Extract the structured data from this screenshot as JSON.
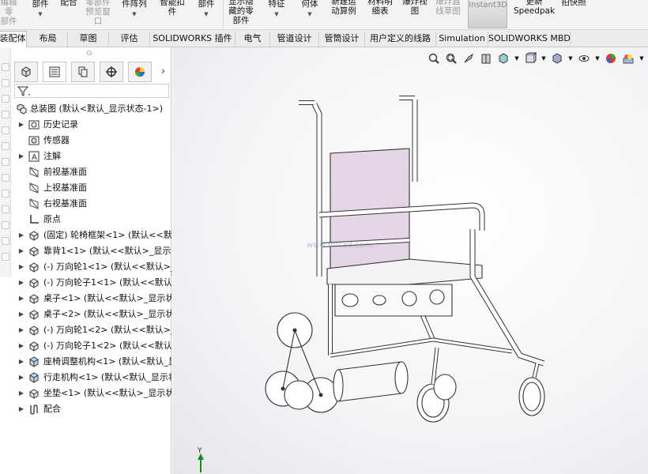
{
  "ribbon": {
    "items": [
      {
        "label": "编辑零\n部件",
        "gray": true
      },
      {
        "label": "部件",
        "dropdown": true
      },
      {
        "label": "配合",
        "dropdown": false
      },
      {
        "label": "零部件\n预览窗\n口",
        "gray": true
      },
      {
        "label": "件阵列",
        "dropdown": true
      },
      {
        "label": "智能扣\n件",
        "dropdown": false
      },
      {
        "label": "部件",
        "dropdown": true
      },
      {
        "label": "显示隐\n藏的零\n部件",
        "dropdown": false
      },
      {
        "label": "特征",
        "dropdown": true
      },
      {
        "label": "何体",
        "dropdown": true
      },
      {
        "label": "新建运\n动算例",
        "dropdown": false
      },
      {
        "label": "材料明\n细表",
        "dropdown": false
      },
      {
        "label": "爆炸视\n图",
        "dropdown": false
      },
      {
        "label": "爆炸直\n线草图",
        "gray": true
      },
      {
        "label": "Instant3D",
        "gray": true
      },
      {
        "label": "更新\nSpeedpak",
        "dropdown": false
      },
      {
        "label": "拍快照",
        "dropdown": false
      }
    ]
  },
  "tabs": [
    {
      "label": "装配体",
      "active": true
    },
    {
      "label": "布局"
    },
    {
      "label": "草图"
    },
    {
      "label": "评估"
    },
    {
      "label": "SOLIDWORKS 插件"
    },
    {
      "label": "电气"
    },
    {
      "label": "管道设计"
    },
    {
      "label": "管筒设计"
    },
    {
      "label": "用户定义的线路"
    },
    {
      "label": "Simulation"
    },
    {
      "label": "SOLIDWORKS MBD"
    }
  ],
  "tree": {
    "root": "总装图  (默认<默认_显示状态-1>)",
    "nodes": [
      {
        "label": "历史记录",
        "icon": "history-icon",
        "expandable": true
      },
      {
        "label": "传感器",
        "icon": "sensor-icon",
        "expandable": false
      },
      {
        "label": "注解",
        "icon": "annotation-icon",
        "expandable": true
      },
      {
        "label": "前视基准面",
        "icon": "plane-icon",
        "expandable": false
      },
      {
        "label": "上视基准面",
        "icon": "plane-icon",
        "expandable": false
      },
      {
        "label": "右视基准面",
        "icon": "plane-icon",
        "expandable": false
      },
      {
        "label": "原点",
        "icon": "origin-icon",
        "expandable": false
      },
      {
        "label": "(固定) 轮椅框架<1> (默认<<默",
        "icon": "part-icon",
        "expandable": true
      },
      {
        "label": "靠背1<1> (默认<<默认>_显示状",
        "icon": "part-icon",
        "expandable": true
      },
      {
        "label": "(-) 万向轮1<1> (默认<<默认>_",
        "icon": "part-icon",
        "expandable": true
      },
      {
        "label": "(-) 万向轮子1<1> (默认<<默认",
        "icon": "part-icon",
        "expandable": true
      },
      {
        "label": "桌子<1> (默认<<默认>_显示状",
        "icon": "part-icon",
        "expandable": true
      },
      {
        "label": "桌子<2> (默认<<默认>_显示状",
        "icon": "part-icon",
        "expandable": true
      },
      {
        "label": "(-) 万向轮1<2> (默认<<默认>_",
        "icon": "part-icon",
        "expandable": true
      },
      {
        "label": "(-) 万向轮子1<2> (默认<<默认",
        "icon": "part-icon",
        "expandable": true
      },
      {
        "label": "座椅调整机构<1> (默认<默认_显",
        "icon": "assembly-icon",
        "expandable": true
      },
      {
        "label": "行走机构<1> (默认<默认_显示状",
        "icon": "assembly-icon",
        "expandable": true
      },
      {
        "label": "坐垫<1> (默认<<默认>_显示状",
        "icon": "part-icon",
        "expandable": true
      },
      {
        "label": "配合",
        "icon": "mate-icon",
        "expandable": true
      }
    ]
  },
  "graphics": {
    "watermark": "www.mfcad.com",
    "triad_label": "Y"
  },
  "colors": {
    "backrest": "#e6d5e6",
    "frame": "#ffffff",
    "outline": "#333333"
  }
}
